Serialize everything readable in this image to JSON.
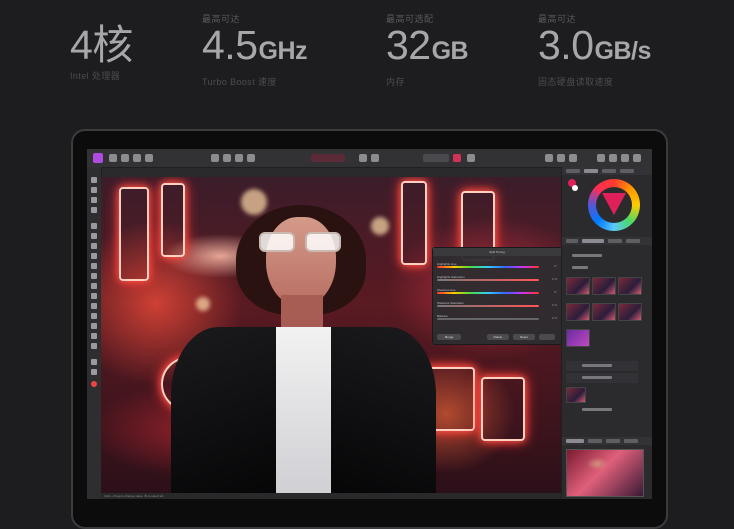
{
  "specs": [
    {
      "caption": "",
      "number": "4核",
      "unit": "",
      "sub": "Intel 处理器"
    },
    {
      "caption": "最高可达",
      "number": "4.5",
      "unit": "GHz",
      "sub": "Turbo Boost 速度"
    },
    {
      "caption": "最高可选配",
      "number": "32",
      "unit": "GB",
      "sub": "内存"
    },
    {
      "caption": "最高可达",
      "number": "3.0",
      "unit": "GB/s",
      "sub": "固态硬盘读取速度"
    }
  ],
  "app": {
    "dialog": {
      "title": "Split Toning",
      "rows": [
        {
          "label": "Highlights Hue",
          "value": "0°"
        },
        {
          "label": "Highlights Saturation",
          "value": "0 %"
        },
        {
          "label": "Shadows Hue",
          "value": "0°"
        },
        {
          "label": "Shadows Saturation",
          "value": "0 %"
        },
        {
          "label": "Balance",
          "value": "0 %"
        }
      ],
      "buttons": {
        "merge": "Merge",
        "delete": "Delete",
        "reset": "Reset"
      }
    },
    "status": "Click + Drag to change value. ⌘ to select all."
  },
  "colors": {
    "background": "#1d1d1f",
    "spec_number": "#a7a7ab",
    "spec_caption": "#5a5a5e",
    "accent_magenta": "#e0205a",
    "app_logo": "#b04be0"
  }
}
